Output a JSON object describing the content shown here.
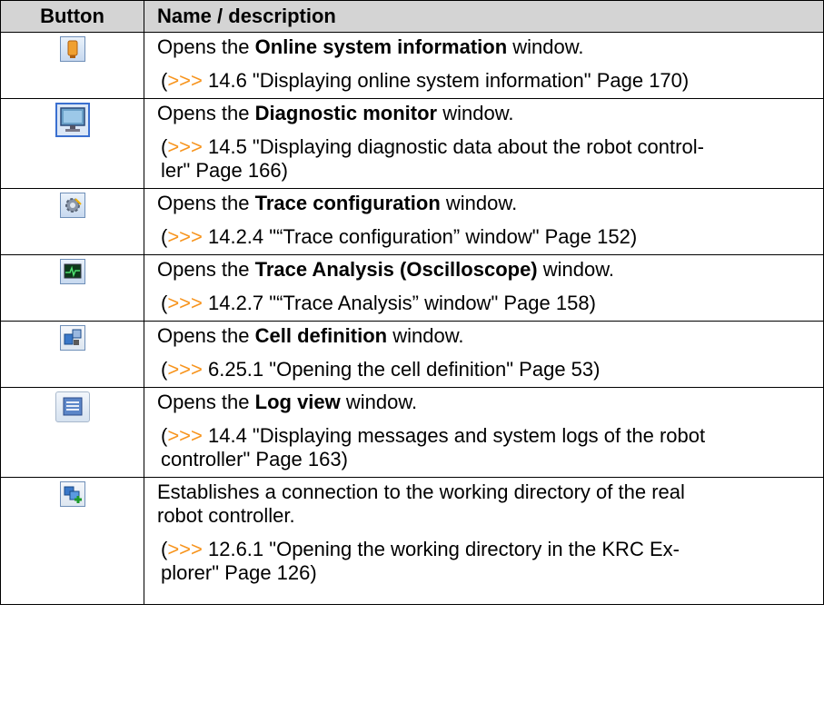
{
  "header": {
    "button": "Button",
    "name_description": "Name / description"
  },
  "rows": [
    {
      "icon": "system-info-icon",
      "pre": "Opens the ",
      "bold": "Online system information",
      "post": " window.",
      "ref_arrow": ">>>",
      "ref_text": " 14.6 \"Displaying online system information\" Page 170)"
    },
    {
      "icon": "diagnostic-monitor-icon",
      "pre": "Opens the ",
      "bold": "Diagnostic monitor",
      "post": " window.",
      "ref_arrow": ">>>",
      "ref_text_1": " 14.5 \"Displaying diagnostic data about the robot control-",
      "ref_text_2": "ler\" Page 166)"
    },
    {
      "icon": "trace-configuration-icon",
      "pre": "Opens the ",
      "bold": "Trace configuration",
      "post": " window.",
      "ref_arrow": ">>>",
      "ref_text": " 14.2.4 \"“Trace configuration” window\" Page 152)"
    },
    {
      "icon": "trace-analysis-icon",
      "pre": "Opens the ",
      "bold": "Trace Analysis (Oscilloscope)",
      "post": " window.",
      "ref_arrow": ">>>",
      "ref_text": " 14.2.7 \"“Trace Analysis” window\" Page 158)"
    },
    {
      "icon": "cell-definition-icon",
      "pre": "Opens the ",
      "bold": "Cell definition",
      "post": " window.",
      "ref_arrow": ">>>",
      "ref_text": " 6.25.1 \"Opening the cell definition\" Page 53)"
    },
    {
      "icon": "log-view-icon",
      "pre": "Opens the ",
      "bold": "Log view",
      "post": " window.",
      "ref_arrow": ">>>",
      "ref_text_1": " 14.4 \"Displaying messages and system logs of the robot",
      "ref_text_2": "controller\" Page 163)"
    },
    {
      "icon": "working-directory-connect-icon",
      "line_1": "Establishes a connection to the working directory of the real",
      "line_2": "robot controller.",
      "ref_arrow": ">>>",
      "ref_text_1": " 12.6.1 \"Opening the working directory in the KRC Ex-",
      "ref_text_2": "plorer\" Page 126)"
    }
  ]
}
